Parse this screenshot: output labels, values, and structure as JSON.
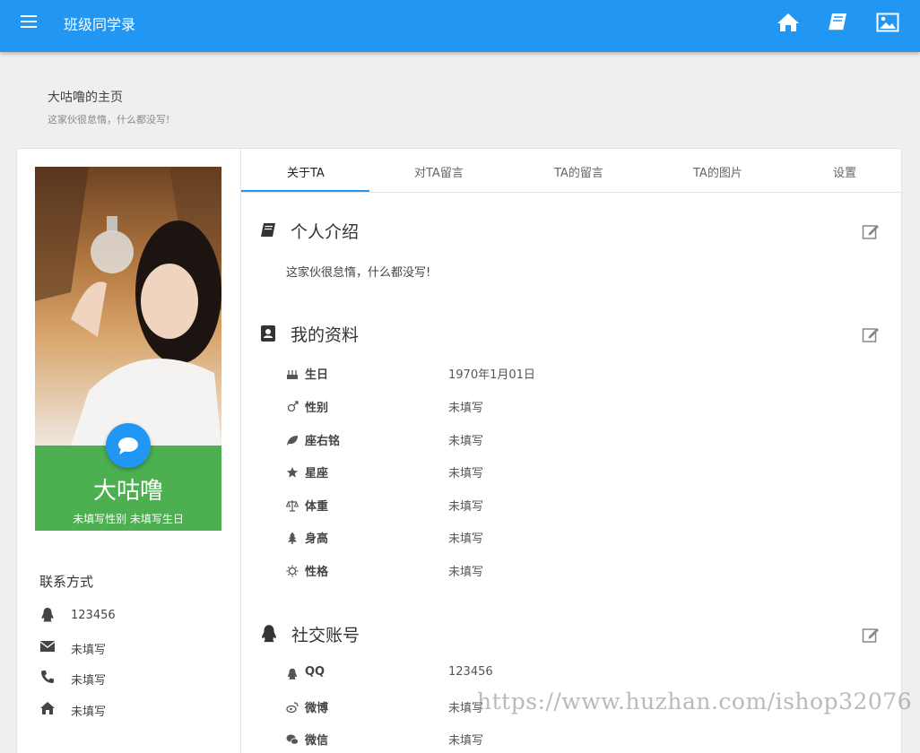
{
  "app": {
    "title": "班级同学录"
  },
  "page": {
    "title": "大咕噜的主页",
    "subtitle": "这家伙很怠惰，什么都没写!"
  },
  "profile": {
    "name": "大咕噜",
    "info_line": "未填写性别 未填写生日"
  },
  "contact": {
    "title": "联系方式",
    "items": [
      {
        "icon": "qq-icon",
        "value": "123456"
      },
      {
        "icon": "envelope-icon",
        "value": "未填写"
      },
      {
        "icon": "phone-icon",
        "value": "未填写"
      },
      {
        "icon": "home-icon",
        "value": "未填写"
      }
    ]
  },
  "tabs": [
    {
      "label": "关于TA",
      "active": true
    },
    {
      "label": "对TA留言"
    },
    {
      "label": "TA的留言"
    },
    {
      "label": "TA的图片"
    },
    {
      "label": "设置"
    }
  ],
  "sections": {
    "intro": {
      "title": "个人介绍",
      "text": "这家伙很怠惰，什么都没写!"
    },
    "profile": {
      "title": "我的资料",
      "rows": [
        {
          "icon": "cake-icon",
          "label": "生日",
          "value": "1970年1月01日"
        },
        {
          "icon": "gender-icon",
          "label": "性别",
          "value": "未填写"
        },
        {
          "icon": "leaf-icon",
          "label": "座右铭",
          "value": "未填写"
        },
        {
          "icon": "star-icon",
          "label": "星座",
          "value": "未填写"
        },
        {
          "icon": "balance-icon",
          "label": "体重",
          "value": "未填写"
        },
        {
          "icon": "tree-icon",
          "label": "身高",
          "value": "未填写"
        },
        {
          "icon": "sun-icon",
          "label": "性格",
          "value": "未填写"
        }
      ]
    },
    "social": {
      "title": "社交账号",
      "rows": [
        {
          "icon": "qq-icon",
          "label": "QQ",
          "value": "123456"
        },
        {
          "icon": "weibo-icon",
          "label": "微博",
          "value": "未填写"
        },
        {
          "icon": "wechat-icon",
          "label": "微信",
          "value": "未填写"
        }
      ]
    }
  },
  "watermark": "https://www.huzhan.com/ishop32076",
  "colors": {
    "primary": "#2196f3",
    "name_panel": "#4caf50"
  }
}
